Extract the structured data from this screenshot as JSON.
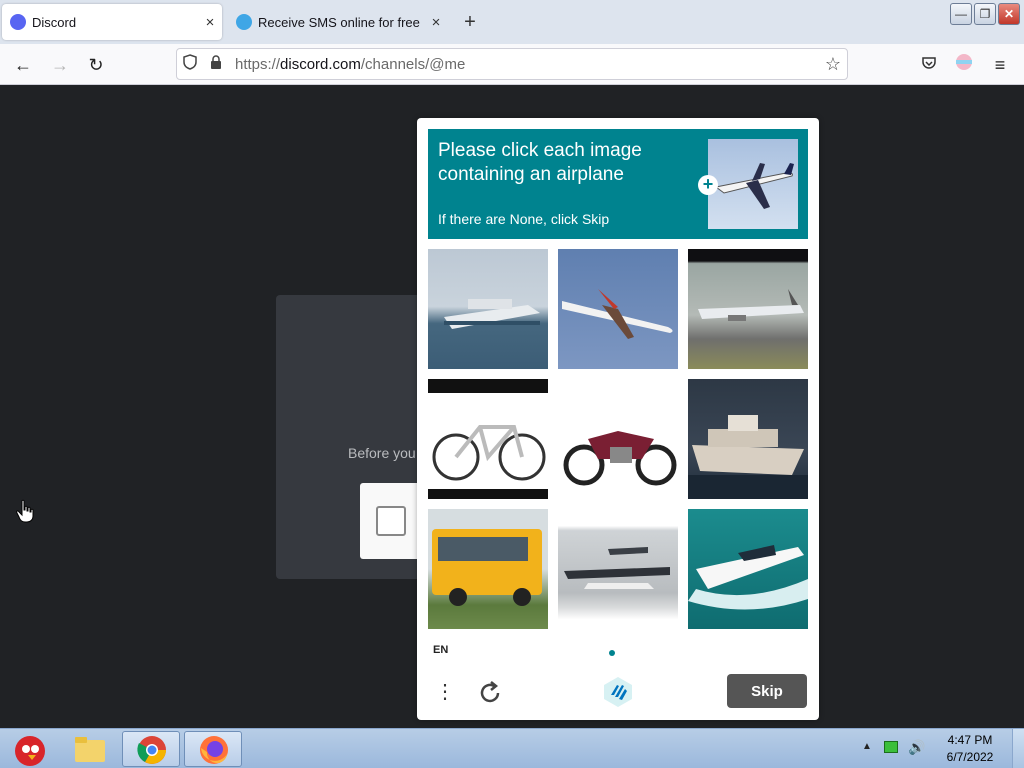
{
  "browser": {
    "tabs": [
      {
        "label": "Discord",
        "close": "×",
        "icon": "discord-favicon"
      },
      {
        "label": "Receive SMS online for free |",
        "close": "×",
        "icon": "sms-favicon"
      }
    ],
    "new_tab": "+",
    "url": {
      "scheme": "https://",
      "host": "discord.com",
      "path": "/channels/@me"
    },
    "window_controls": {
      "minimize": "—",
      "maximize": "❐",
      "close": "✕"
    },
    "nav": {
      "back": "←",
      "forward": "→",
      "reload": "↻"
    },
    "toolbar_icons": [
      "pocket-icon",
      "account-icon",
      "menu-icon"
    ]
  },
  "discord": {
    "verify_text": "Before you",
    "background": "#202225",
    "card_color": "#36393f"
  },
  "captcha": {
    "prompt_title": "Please click each image containing an airplane",
    "prompt_sub": "If there are None, click Skip",
    "prompt_plus": "+",
    "accent": "#00838f",
    "tiles": [
      {
        "subject": "ship"
      },
      {
        "subject": "airplane"
      },
      {
        "subject": "airplane"
      },
      {
        "subject": "bicycle"
      },
      {
        "subject": "motorcycle"
      },
      {
        "subject": "yacht"
      },
      {
        "subject": "bus"
      },
      {
        "subject": "seaplane"
      },
      {
        "subject": "speedboat"
      }
    ],
    "language": "EN",
    "menu_label": "⋮",
    "skip_label": "Skip"
  },
  "taskbar": {
    "apps": [
      "angry-birds-icon",
      "folder-icon",
      "chrome-icon",
      "firefox-icon"
    ],
    "time": "4:47 PM",
    "date": "6/7/2022"
  }
}
